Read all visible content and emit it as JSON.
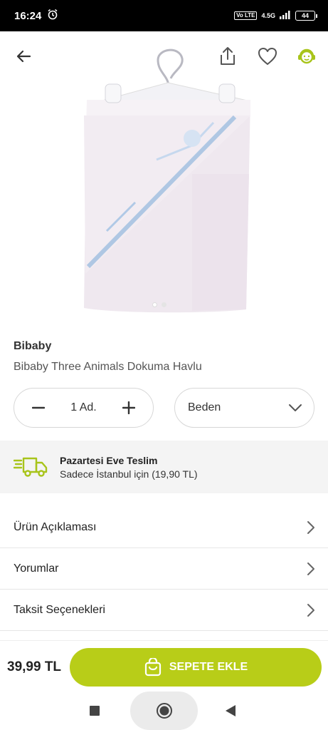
{
  "status_bar": {
    "time": "16:24",
    "network_label": "4.5G",
    "volte": "Vo LTE",
    "battery": "44"
  },
  "product": {
    "brand": "Bibaby",
    "name": "Bibaby Three Animals Dokuma Havlu",
    "image_page_index": 1,
    "image_page_count": 2
  },
  "quantity": {
    "value": "1 Ad.",
    "minus": "−",
    "plus": "+"
  },
  "size_select": {
    "label": "Beden"
  },
  "delivery": {
    "title": "Pazartesi Eve Teslim",
    "subtitle": "Sadece İstanbul için (19,90 TL)"
  },
  "sections": [
    {
      "label": "Ürün Açıklaması"
    },
    {
      "label": "Yorumlar"
    },
    {
      "label": "Taksit Seçenekleri"
    }
  ],
  "bottom": {
    "price": "39,99 TL",
    "cart_button": "SEPETE EKLE"
  },
  "colors": {
    "accent": "#b8cd18",
    "text": "#222222",
    "divider": "#e6e6e6",
    "delivery_bg": "#f4f4f4"
  },
  "icons": [
    "back-arrow-icon",
    "share-icon",
    "heart-icon",
    "support-agent-icon",
    "minus-icon",
    "plus-icon",
    "chevron-down-icon",
    "truck-icon",
    "chevron-right-icon",
    "cart-bag-icon",
    "nav-square-icon",
    "nav-circle-icon",
    "nav-back-triangle-icon",
    "alarm-icon"
  ]
}
